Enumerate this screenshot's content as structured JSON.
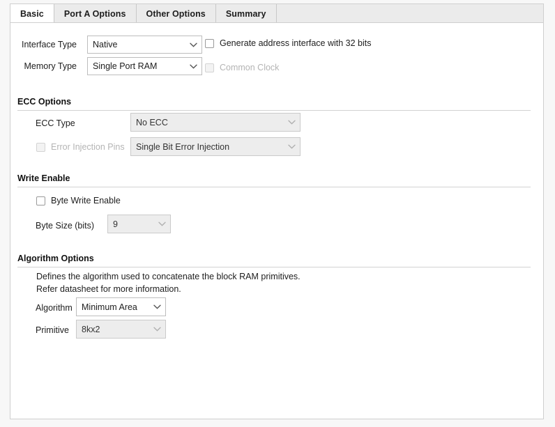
{
  "tabs": [
    {
      "label": "Basic",
      "active": true
    },
    {
      "label": "Port A Options",
      "active": false
    },
    {
      "label": "Other Options",
      "active": false
    },
    {
      "label": "Summary",
      "active": false
    }
  ],
  "basic": {
    "interface_type_label": "Interface Type",
    "interface_type_value": "Native",
    "memory_type_label": "Memory Type",
    "memory_type_value": "Single Port RAM",
    "generate_address_label": "Generate address interface with 32 bits",
    "common_clock_label": "Common Clock"
  },
  "ecc": {
    "section_label": "ECC Options",
    "ecc_type_label": "ECC Type",
    "ecc_type_value": "No ECC",
    "error_injection_label": "Error Injection Pins",
    "error_injection_value": "Single Bit Error Injection"
  },
  "write_enable": {
    "section_label": "Write Enable",
    "byte_write_enable_label": "Byte Write Enable",
    "byte_size_label": "Byte Size (bits)",
    "byte_size_value": "9"
  },
  "algorithm": {
    "section_label": "Algorithm Options",
    "description_line1": "Defines the algorithm used to concatenate the block RAM primitives.",
    "description_line2": "Refer datasheet for more information.",
    "algorithm_label": "Algorithm",
    "algorithm_value": "Minimum Area",
    "primitive_label": "Primitive",
    "primitive_value": "8kx2"
  },
  "colors": {
    "panel_bg": "#ffffff",
    "tab_bg": "#ebebeb",
    "border": "#cfcfcf",
    "disabled_text": "#b4b4b4",
    "disabled_field_bg": "#ededed"
  }
}
